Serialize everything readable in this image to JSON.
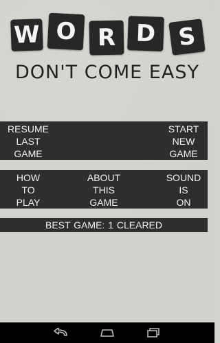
{
  "logo": {
    "letters": [
      "W",
      "O",
      "R",
      "D",
      "S"
    ]
  },
  "subtitle": "DON'T COME EASY",
  "menu": {
    "resume": "RESUME\nLAST\nGAME",
    "start": "START\nNEW\nGAME",
    "how_to_play": "HOW\nTO\nPLAY",
    "about": "ABOUT\nTHIS\nGAME",
    "sound": "SOUND\nIS\nON"
  },
  "best_game": "BEST GAME:  1 CLEARED",
  "navbar": {
    "icons": [
      "back-icon",
      "home-icon",
      "recent-apps-icon"
    ]
  },
  "colors": {
    "background": "#d2d1cc",
    "bar": "#2e2e2e",
    "tile": "#272727",
    "text_dark": "#222222",
    "text_light": "#f2f2f2"
  }
}
